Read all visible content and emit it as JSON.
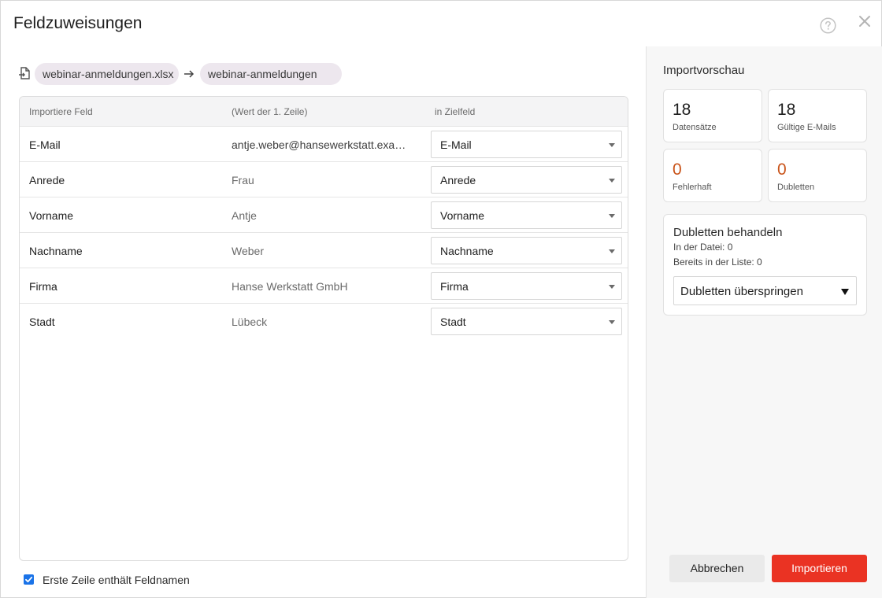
{
  "dialog": {
    "title": "Feldzuweisungen"
  },
  "source": {
    "file": "webinar-anmeldungen.xlsx",
    "target": "webinar-anmeldungen"
  },
  "table": {
    "headers": {
      "field": "Importiere Feld",
      "value": "(Wert der 1. Zeile)",
      "target": "in Zielfeld"
    },
    "rows": [
      {
        "field": "E-Mail",
        "value": "antje.weber@hansewerkstatt.example.de",
        "target": "E-Mail"
      },
      {
        "field": "Anrede",
        "value": "Frau",
        "target": "Anrede"
      },
      {
        "field": "Vorname",
        "value": "Antje",
        "target": "Vorname"
      },
      {
        "field": "Nachname",
        "value": "Weber",
        "target": "Nachname"
      },
      {
        "field": "Firma",
        "value": "Hanse Werkstatt GmbH",
        "target": "Firma"
      },
      {
        "field": "Stadt",
        "value": "Lübeck",
        "target": "Stadt"
      }
    ]
  },
  "options": {
    "first_row_header_label": "Erste Zeile enthält Feldnamen",
    "first_row_header_checked": true
  },
  "preview": {
    "title": "Importvorschau",
    "stats": [
      {
        "value": "18",
        "label": "Datensätze"
      },
      {
        "value": "18",
        "label": "Gültige E-Mails"
      },
      {
        "value": "0",
        "label": "Fehlerhaft"
      },
      {
        "value": "0",
        "label": "Dubletten"
      }
    ],
    "duplicates": {
      "title": "Dubletten behandeln",
      "in_file": "In der Datei: 0",
      "in_list": "Bereits in der Liste: 0",
      "selected": "Dubletten überspringen"
    }
  },
  "buttons": {
    "cancel": "Abbrechen",
    "import": "Importieren"
  },
  "colors": {
    "accent": "#ea3323",
    "warning_number": "#c9541a",
    "checkbox": "#1a73e8",
    "chip": "#ede7ee"
  }
}
